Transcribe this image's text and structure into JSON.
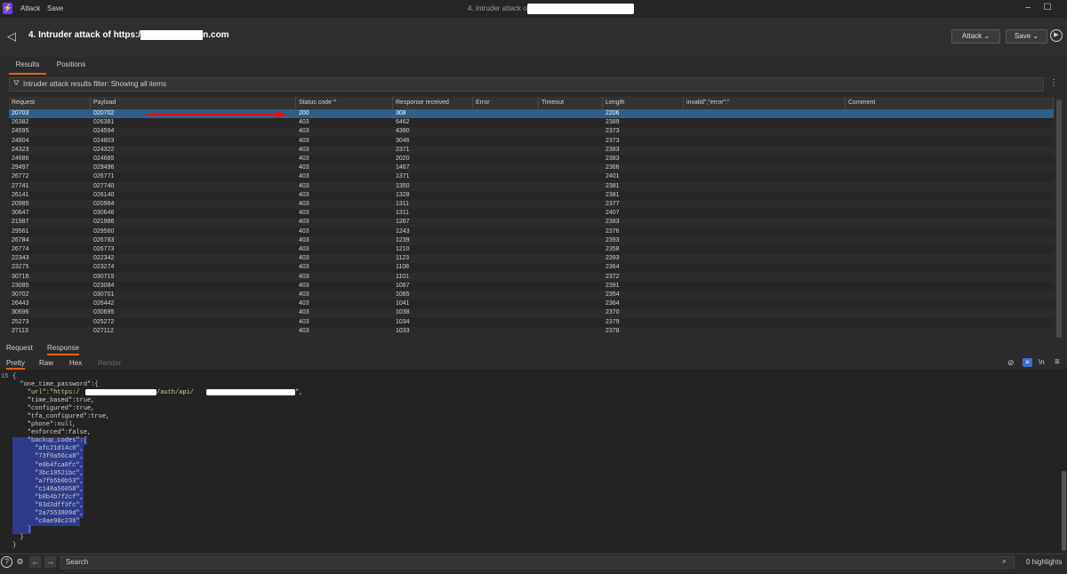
{
  "titlebar": {
    "menu": [
      "Attack",
      "Save"
    ],
    "window_title": "4. Intruder attack of"
  },
  "header": {
    "title": "4. Intruder attack of https:/",
    "title_suffix": "n.com",
    "attack_button": "Attack ⌄",
    "save_button": "Save ⌄"
  },
  "tabs": [
    "Results",
    "Positions"
  ],
  "filter": {
    "text": "Intruder attack results filter: Showing all items"
  },
  "table": {
    "columns": [
      "Request",
      "Payload",
      "Status code ^",
      "Response received",
      "Error",
      "Timeout",
      "Length",
      "invalid\",\"error\":\"",
      "Comment"
    ],
    "rows": [
      [
        "20703",
        "020702",
        "200",
        "308",
        "",
        "",
        "2206",
        "",
        ""
      ],
      [
        "26382",
        "026381",
        "403",
        "6462",
        "",
        "",
        "2389",
        "",
        ""
      ],
      [
        "24595",
        "024594",
        "403",
        "4390",
        "",
        "",
        "2373",
        "",
        ""
      ],
      [
        "24804",
        "024803",
        "403",
        "3046",
        "",
        "",
        "2373",
        "",
        ""
      ],
      [
        "24323",
        "024322",
        "403",
        "2371",
        "",
        "",
        "2383",
        "",
        ""
      ],
      [
        "24686",
        "024685",
        "403",
        "2020",
        "",
        "",
        "2383",
        "",
        ""
      ],
      [
        "29497",
        "029496",
        "403",
        "1467",
        "",
        "",
        "2366",
        "",
        ""
      ],
      [
        "26772",
        "026771",
        "403",
        "1371",
        "",
        "",
        "2401",
        "",
        ""
      ],
      [
        "27741",
        "027740",
        "403",
        "1350",
        "",
        "",
        "2381",
        "",
        ""
      ],
      [
        "26141",
        "026140",
        "403",
        "1328",
        "",
        "",
        "2381",
        "",
        ""
      ],
      [
        "20985",
        "020984",
        "403",
        "1311",
        "",
        "",
        "2377",
        "",
        ""
      ],
      [
        "30647",
        "030646",
        "403",
        "1311",
        "",
        "",
        "2407",
        "",
        ""
      ],
      [
        "21987",
        "021986",
        "403",
        "1267",
        "",
        "",
        "2383",
        "",
        ""
      ],
      [
        "29561",
        "029560",
        "403",
        "1243",
        "",
        "",
        "2376",
        "",
        ""
      ],
      [
        "26784",
        "026783",
        "403",
        "1239",
        "",
        "",
        "2393",
        "",
        ""
      ],
      [
        "26774",
        "026773",
        "403",
        "1210",
        "",
        "",
        "2358",
        "",
        ""
      ],
      [
        "22343",
        "022342",
        "403",
        "1123",
        "",
        "",
        "2393",
        "",
        ""
      ],
      [
        "23275",
        "023274",
        "403",
        "1108",
        "",
        "",
        "2364",
        "",
        ""
      ],
      [
        "30716",
        "030715",
        "403",
        "1101",
        "",
        "",
        "2372",
        "",
        ""
      ],
      [
        "23085",
        "023084",
        "403",
        "1067",
        "",
        "",
        "2391",
        "",
        ""
      ],
      [
        "30702",
        "030701",
        "403",
        "1065",
        "",
        "",
        "2354",
        "",
        ""
      ],
      [
        "26443",
        "026442",
        "403",
        "1041",
        "",
        "",
        "2364",
        "",
        ""
      ],
      [
        "30696",
        "030695",
        "403",
        "1038",
        "",
        "",
        "2370",
        "",
        ""
      ],
      [
        "25273",
        "025272",
        "403",
        "1034",
        "",
        "",
        "2379",
        "",
        ""
      ],
      [
        "27113",
        "027112",
        "403",
        "1033",
        "",
        "",
        "2378",
        "",
        ""
      ]
    ]
  },
  "message_tabs": [
    "Request",
    "Response"
  ],
  "view_tabs": [
    "Pretty",
    "Raw",
    "Hex",
    "Render"
  ],
  "editor": {
    "first_line_number": "15",
    "lines": [
      "{",
      "  \"one_time_password\":{",
      "    \"url\":\"https:/",
      "    \"time_based\":true,",
      "    \"configured\":true,",
      "    \"tfa_configured\":true,",
      "    \"phone\":null,",
      "    \"enforced\":false,",
      "    \"backup_codes\":[",
      "      \"afc21d14c0\",",
      "      \"73f0a56ca8\",",
      "      \"e0b4fca0fc\",",
      "      \"3bc19521bc\",",
      "      \"a7fb5b0b53\",",
      "      \"c148a56058\",",
      "      \"b0b4b7f2cf\",",
      "      \"83d3dff3fc\",",
      "      \"2a7553809d\",",
      "      \"c0ae98c236\"",
      "    ]",
      "  }",
      "}"
    ],
    "url_middle": "/auth/api/",
    "url_end": "\","
  },
  "bottombar": {
    "search_placeholder": "Search",
    "highlights": "0 highlights"
  }
}
